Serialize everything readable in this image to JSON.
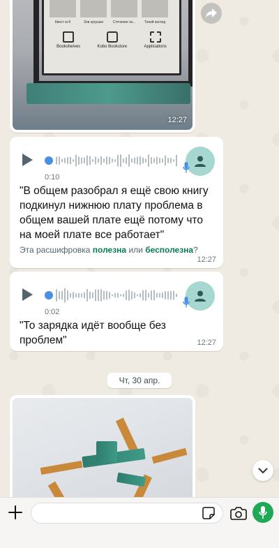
{
  "messages": [
    {
      "type": "image",
      "time": "12:27"
    },
    {
      "type": "voice",
      "duration": "0:10",
      "transcript": "\"В общем разобрал я ещё свою книгу подкинул нижнюю плату проблема в общем вашей плате ещё потому что на моей плате все работает\"",
      "feedback_prefix": "Эта расшифровка ",
      "feedback_useful": "полезна",
      "feedback_or": " или ",
      "feedback_useless": "бесполезна",
      "feedback_suffix": "?",
      "time": "12:27"
    },
    {
      "type": "voice",
      "duration": "0:02",
      "transcript": "\"То зарядка идёт вообще без проблем\"",
      "time": "12:27"
    },
    {
      "type": "image"
    }
  ],
  "date_separator": "Чт, 30 апр.",
  "photo_labels": {
    "caps": [
      "Квест м-б",
      "Зов кукушки",
      "Стечение ок...",
      "Тихий взгляд"
    ],
    "tiles": [
      "Bookshelves",
      "Kobo Bookstore",
      "Applications"
    ]
  },
  "composer": {
    "input_value": "",
    "input_placeholder": ""
  },
  "colors": {
    "accent": "#1fa855",
    "link": "#0b7a55",
    "bubble": "#ffffff",
    "background": "#efeae2"
  },
  "icons": [
    "forward-icon",
    "play-icon",
    "mic-icon",
    "avatar-person-icon",
    "chevron-down-icon",
    "plus-icon",
    "sticker-icon",
    "camera-icon"
  ]
}
